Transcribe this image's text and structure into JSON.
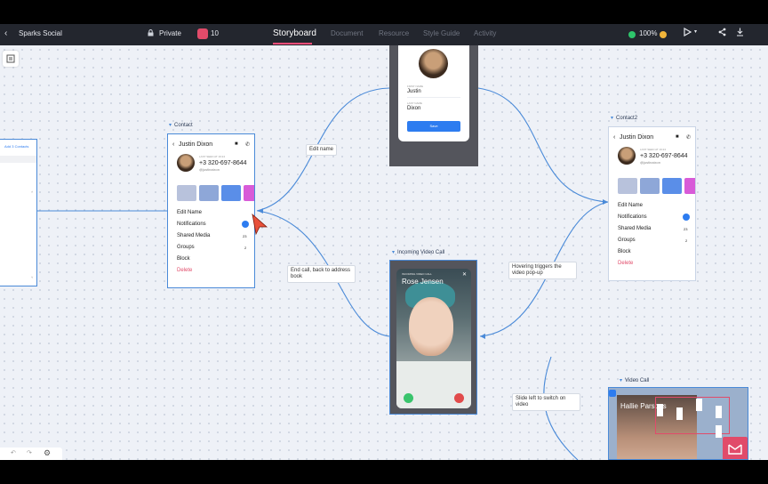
{
  "app": {
    "project_name": "Sparks Social",
    "privacy": "Private",
    "comment_count": "10",
    "zoom": "100%"
  },
  "tabs": [
    {
      "label": "Storyboard",
      "active": true
    },
    {
      "label": "Document",
      "active": false
    },
    {
      "label": "Resource",
      "active": false
    },
    {
      "label": "Style Guide",
      "active": false
    },
    {
      "label": "Activity",
      "active": false
    }
  ],
  "colors": {
    "accent": "#4a8ad8",
    "topbar_bg": "#23262e",
    "canvas_bg": "#eef1f7",
    "danger": "#e14b6a",
    "primary_button": "#2d7cf0"
  },
  "frames": {
    "contact": {
      "title": "Contact",
      "header_name": "Justin Dixon",
      "last_seen": "LAST SEEN AT 19:24",
      "phone": "+3 320-697-8644",
      "handle": "@justinaixon",
      "actions": [
        "Edit Name",
        "Notifications",
        "Shared Media",
        "Groups",
        "Block",
        "Delete"
      ],
      "shared_media_count": "23",
      "groups_count": "2"
    },
    "contact2": {
      "title": "Contact2",
      "header_name": "Justin Dixon",
      "last_seen": "LAST SEEN AT 19:24",
      "phone": "+3 320-697-8644",
      "handle": "@justinaixon",
      "actions": [
        "Edit Name",
        "Notifications",
        "Shared Media",
        "Groups",
        "Block",
        "Delete"
      ],
      "shared_media_count": "23",
      "groups_count": "2"
    },
    "edit_name": {
      "first_name_label": "FIRST NAME",
      "first_name": "Justin",
      "last_name_label": "LAST NAME",
      "last_name": "Dixon",
      "save_label": "Save"
    },
    "incoming_call": {
      "title": "Incoming Video Call",
      "caller_name": "Rose Jensen",
      "call_status": "INCOMING VIDEO CALL"
    },
    "video_call": {
      "title": "Video Call",
      "caller_name": "Hallie Parsons"
    },
    "left_partial": {
      "link_text": "Add 3 Contacts"
    }
  },
  "flow_labels": [
    {
      "text": "Edit name"
    },
    {
      "text": "End call,  back to address book"
    },
    {
      "text": "Hovering triggers the video pop-up"
    },
    {
      "text": "Slide left to switch on video"
    }
  ],
  "icons": {
    "back": "chevron-left-icon",
    "lock": "lock-icon",
    "play": "play-icon",
    "share": "share-icon",
    "download": "download-icon",
    "layers": "layers-icon",
    "settings": "gear-icon"
  }
}
